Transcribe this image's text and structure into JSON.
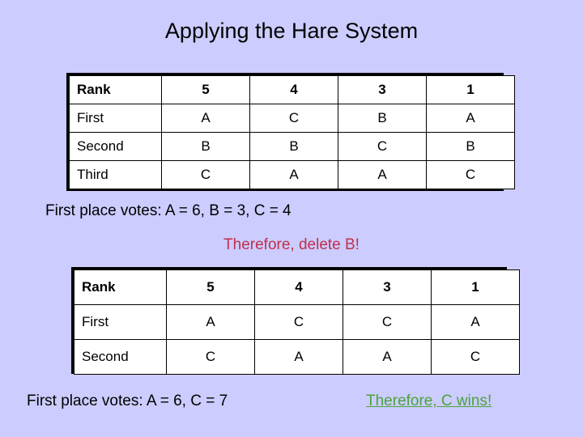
{
  "slide": {
    "title": "Applying the Hare System",
    "background_color": "#ccccff"
  },
  "table1": {
    "name": "initial-preference-schedule",
    "columns": [
      "Rank",
      "5",
      "4",
      "3",
      "1"
    ],
    "rows": [
      {
        "label": "First",
        "values": [
          "A",
          "C",
          "B",
          "A"
        ]
      },
      {
        "label": "Second",
        "values": [
          "B",
          "B",
          "C",
          "B"
        ]
      },
      {
        "label": "Third",
        "values": [
          "C",
          "A",
          "A",
          "C"
        ]
      }
    ]
  },
  "table2": {
    "name": "reduced-preference-schedule",
    "columns": [
      "Rank",
      "5",
      "4",
      "3",
      "1"
    ],
    "rows": [
      {
        "label": "First",
        "values": [
          "A",
          "C",
          "C",
          "A"
        ]
      },
      {
        "label": "Second",
        "values": [
          "C",
          "A",
          "A",
          "C"
        ]
      }
    ]
  },
  "notes": {
    "votes_line_1": "First place votes: A = 6, B = 3, C = 4",
    "delete_line": "Therefore, delete B!",
    "delete_line_color": "#c0304a",
    "votes_line_2": "First place votes: A = 6, C = 7",
    "winner_line": "Therefore, C wins!",
    "winner_line_color": "#4ba23c"
  }
}
